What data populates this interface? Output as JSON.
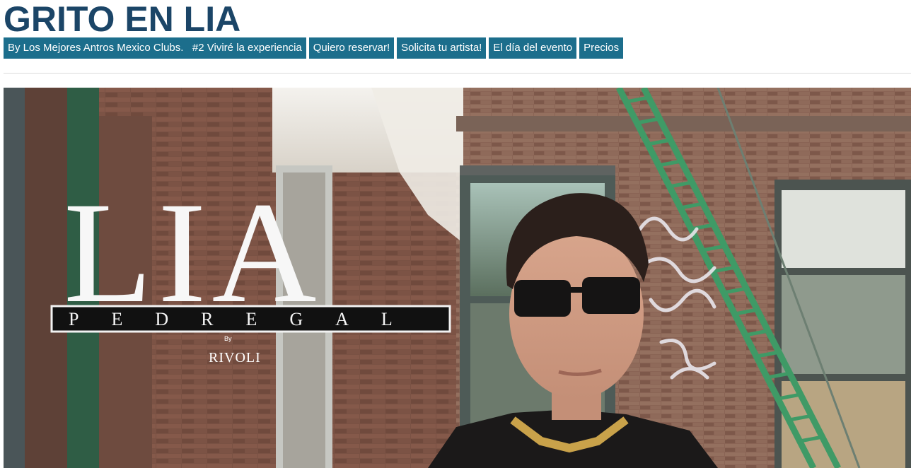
{
  "page": {
    "title": "GRITO EN LIA"
  },
  "nav": {
    "items": [
      {
        "label": "By Los Mejores Antros Mexico Clubs.   #2 Viviré la experiencia"
      },
      {
        "label": "Quiero reservar!"
      },
      {
        "label": "Solicita tu artista!"
      },
      {
        "label": "El día del evento"
      },
      {
        "label": "Precios"
      }
    ]
  },
  "hero": {
    "logo_main": "LIA",
    "logo_sub": "PEDREGAL",
    "logo_by": "By",
    "logo_brand": "RIVOLI"
  },
  "colors": {
    "title": "#1b4567",
    "nav_bg": "#1c6e8c",
    "nav_text": "#ffffff"
  }
}
